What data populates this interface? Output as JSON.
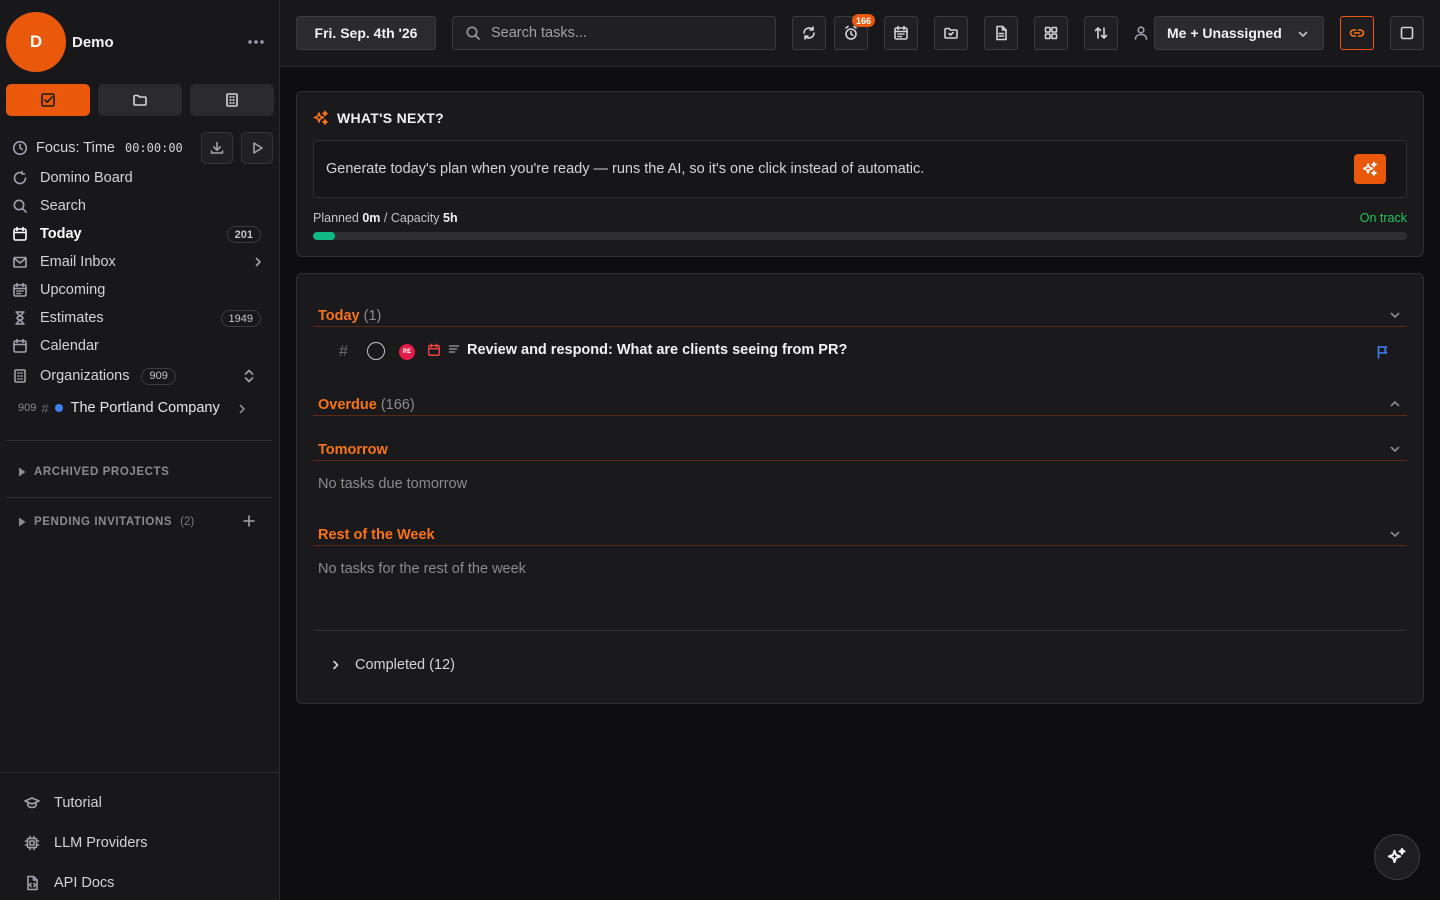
{
  "user": {
    "initial": "D",
    "name": "Demo"
  },
  "focus": {
    "label": "Focus: Time",
    "time": "00:00:00"
  },
  "nav": {
    "items": [
      {
        "label": "Domino Board",
        "icon": "domino-icon"
      },
      {
        "label": "Search",
        "icon": "search-icon"
      },
      {
        "label": "Today",
        "icon": "calendar-icon",
        "count": "201",
        "active": true
      },
      {
        "label": "Email Inbox",
        "icon": "mail-icon"
      },
      {
        "label": "Upcoming",
        "icon": "calendar-grid-icon"
      },
      {
        "label": "Estimates",
        "icon": "hourglass-icon",
        "count": "1949"
      },
      {
        "label": "Calendar",
        "icon": "calendar-icon"
      }
    ],
    "organizations": {
      "label": "Organizations",
      "count": "909"
    },
    "project": {
      "count": "909",
      "name": "The Portland Company",
      "color": "#3b82f6"
    }
  },
  "sections": {
    "archived": "ARCHIVED PROJECTS",
    "pending": "PENDING INVITATIONS",
    "pending_count": "(2)"
  },
  "bottom_nav": [
    {
      "label": "Tutorial",
      "icon": "graduation-cap-icon"
    },
    {
      "label": "LLM Providers",
      "icon": "chip-icon"
    },
    {
      "label": "API Docs",
      "icon": "code-file-icon"
    }
  ],
  "topbar": {
    "date": "Fri. Sep. 4th '26",
    "search_placeholder": "Search tasks...",
    "overdue_badge": "166",
    "assignee": "Me + Unassigned"
  },
  "whats_next": {
    "title": "WHAT'S NEXT?",
    "message": "Generate today's plan when you're ready — runs the AI, so it's one click instead of automatic.",
    "planned_label": "Planned",
    "planned_value": "0m",
    "capacity_label": "Capacity",
    "capacity_value": "5h",
    "status": "On track",
    "progress_fraction": 0.02
  },
  "task_groups": {
    "today": {
      "title": "Today",
      "count": "(1)"
    },
    "overdue": {
      "title": "Overdue",
      "count": "(166)"
    },
    "tomorrow": {
      "title": "Tomorrow",
      "empty": "No tasks due tomorrow"
    },
    "rest_of_week": {
      "title": "Rest of the Week",
      "empty": "No tasks for the rest of the week"
    },
    "completed": {
      "label": "Completed (12)"
    }
  },
  "tasks": [
    {
      "title": "Review and respond: What are clients seeing from PR?",
      "priority_label": "RE",
      "priority_color": "#e11d48"
    }
  ],
  "colors": {
    "accent": "#ea580c",
    "success": "#10b981",
    "flag": "#3b82f6"
  }
}
